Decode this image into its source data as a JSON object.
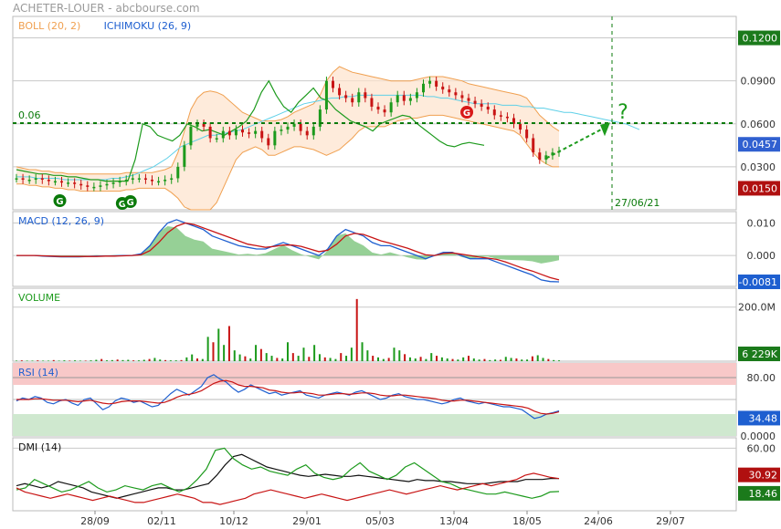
{
  "header": {
    "title": "ACHETER-LOUER - abcbourse.com"
  },
  "colors": {
    "green": "#1c9a1c",
    "darkgreen": "#0a7a0a",
    "red": "#c81414",
    "blue": "#1e5fd0",
    "orange": "#f0a050",
    "cyan": "#5fd0e8",
    "pink_band": "#f8c8c8",
    "green_band": "#cfe8cf",
    "grid": "#c8c8c8",
    "black": "#111111"
  },
  "chart_data": [
    {
      "name": "price",
      "type": "line",
      "legend": [
        {
          "label": "BOLL (20, 2)",
          "color": "#f0a050"
        },
        {
          "label": "ICHIMOKU (26, 9)",
          "color": "#1e5fd0"
        }
      ],
      "y_ticks": [
        "0.1200",
        "0.0900",
        "0.0600",
        "0.0300"
      ],
      "y_tick_values": [
        0.12,
        0.09,
        0.06,
        0.03
      ],
      "ylim": [
        0.0,
        0.135
      ],
      "hline_label": "0.06",
      "hline_value": 0.0605,
      "last_value_label": "0.0457",
      "last_value": 0.0457,
      "red_label": "0.0150",
      "red_value": 0.015,
      "top_label": "0.1200",
      "vline_date_label": "27/06/21",
      "question_mark": "?",
      "signals": [
        {
          "label": "G",
          "color": "#0a7a0a",
          "x_frac": 0.08
        },
        {
          "label": "G",
          "color": "#0a7a0a",
          "x_frac": 0.195
        },
        {
          "label": "G",
          "color": "#0a7a0a",
          "x_frac": 0.21
        },
        {
          "label": "G",
          "color": "#d81818",
          "x_frac": 0.83
        }
      ],
      "close": [
        0.022,
        0.021,
        0.021,
        0.022,
        0.021,
        0.02,
        0.02,
        0.019,
        0.019,
        0.018,
        0.017,
        0.016,
        0.016,
        0.017,
        0.018,
        0.019,
        0.02,
        0.021,
        0.022,
        0.022,
        0.021,
        0.02,
        0.02,
        0.021,
        0.022,
        0.03,
        0.045,
        0.058,
        0.06,
        0.058,
        0.05,
        0.05,
        0.055,
        0.052,
        0.056,
        0.054,
        0.053,
        0.055,
        0.05,
        0.045,
        0.055,
        0.056,
        0.058,
        0.06,
        0.055,
        0.052,
        0.058,
        0.07,
        0.09,
        0.085,
        0.08,
        0.078,
        0.075,
        0.082,
        0.078,
        0.072,
        0.07,
        0.068,
        0.075,
        0.08,
        0.076,
        0.078,
        0.082,
        0.088,
        0.09,
        0.086,
        0.084,
        0.082,
        0.08,
        0.078,
        0.076,
        0.074,
        0.072,
        0.07,
        0.066,
        0.065,
        0.064,
        0.06,
        0.056,
        0.05,
        0.04,
        0.035,
        0.038,
        0.04,
        0.041
      ],
      "bb_upper": [
        0.03,
        0.029,
        0.028,
        0.028,
        0.027,
        0.027,
        0.026,
        0.026,
        0.025,
        0.025,
        0.025,
        0.025,
        0.025,
        0.025,
        0.025,
        0.025,
        0.025,
        0.026,
        0.026,
        0.026,
        0.026,
        0.026,
        0.027,
        0.028,
        0.03,
        0.04,
        0.055,
        0.07,
        0.078,
        0.082,
        0.083,
        0.082,
        0.08,
        0.076,
        0.072,
        0.068,
        0.066,
        0.064,
        0.062,
        0.062,
        0.062,
        0.063,
        0.065,
        0.068,
        0.07,
        0.072,
        0.074,
        0.08,
        0.09,
        0.096,
        0.1,
        0.098,
        0.096,
        0.095,
        0.094,
        0.093,
        0.092,
        0.091,
        0.09,
        0.09,
        0.09,
        0.09,
        0.091,
        0.092,
        0.093,
        0.093,
        0.093,
        0.092,
        0.091,
        0.09,
        0.088,
        0.087,
        0.086,
        0.085,
        0.084,
        0.083,
        0.082,
        0.081,
        0.08,
        0.078,
        0.072,
        0.066,
        0.062,
        0.058,
        0.055
      ],
      "bb_lower": [
        0.018,
        0.018,
        0.017,
        0.017,
        0.016,
        0.016,
        0.015,
        0.015,
        0.014,
        0.014,
        0.013,
        0.013,
        0.013,
        0.013,
        0.013,
        0.013,
        0.013,
        0.014,
        0.014,
        0.015,
        0.015,
        0.015,
        0.015,
        0.015,
        0.012,
        0.008,
        0.002,
        -0.008,
        -0.012,
        -0.01,
        -0.005,
        0.005,
        0.015,
        0.025,
        0.035,
        0.04,
        0.042,
        0.044,
        0.042,
        0.038,
        0.038,
        0.04,
        0.042,
        0.044,
        0.044,
        0.043,
        0.042,
        0.04,
        0.038,
        0.04,
        0.042,
        0.046,
        0.05,
        0.055,
        0.058,
        0.058,
        0.058,
        0.058,
        0.06,
        0.062,
        0.063,
        0.064,
        0.064,
        0.065,
        0.066,
        0.066,
        0.066,
        0.065,
        0.064,
        0.063,
        0.062,
        0.061,
        0.06,
        0.059,
        0.058,
        0.057,
        0.056,
        0.055,
        0.052,
        0.046,
        0.04,
        0.035,
        0.032,
        0.03,
        0.03
      ],
      "ichimoku_lagging": [
        0.028,
        0.027,
        0.026,
        0.025,
        0.025,
        0.024,
        0.024,
        0.023,
        0.023,
        0.022,
        0.021,
        0.021,
        0.02,
        0.02,
        0.02,
        0.02,
        0.035,
        0.06,
        0.058,
        0.052,
        0.05,
        0.048,
        0.052,
        0.06,
        0.058,
        0.055,
        0.056,
        0.054,
        0.052,
        0.055,
        0.058,
        0.062,
        0.07,
        0.082,
        0.09,
        0.08,
        0.072,
        0.068,
        0.075,
        0.08,
        0.085,
        0.078,
        0.076,
        0.07,
        0.066,
        0.062,
        0.06,
        0.058,
        0.055,
        0.06,
        0.062,
        0.064,
        0.066,
        0.065,
        0.06,
        0.056,
        0.052,
        0.048,
        0.045,
        0.044,
        0.046,
        0.047,
        0.046,
        0.045
      ],
      "ichimoku_cloud": [
        0.023,
        0.023,
        0.023,
        0.022,
        0.022,
        0.022,
        0.022,
        0.021,
        0.021,
        0.021,
        0.021,
        0.021,
        0.021,
        0.021,
        0.022,
        0.022,
        0.023,
        0.024,
        0.026,
        0.028,
        0.03,
        0.033,
        0.036,
        0.04,
        0.044,
        0.046,
        0.048,
        0.05,
        0.052,
        0.052,
        0.053,
        0.054,
        0.055,
        0.056,
        0.058,
        0.06,
        0.062,
        0.064,
        0.066,
        0.068,
        0.07,
        0.072,
        0.074,
        0.075,
        0.076,
        0.077,
        0.078,
        0.078,
        0.079,
        0.079,
        0.08,
        0.08,
        0.08,
        0.08,
        0.08,
        0.08,
        0.08,
        0.08,
        0.08,
        0.08,
        0.079,
        0.079,
        0.078,
        0.078,
        0.077,
        0.076,
        0.075,
        0.074,
        0.074,
        0.074,
        0.074,
        0.073,
        0.073,
        0.073,
        0.072,
        0.072,
        0.071,
        0.071,
        0.07,
        0.069,
        0.068,
        0.068,
        0.067,
        0.066,
        0.065,
        0.064,
        0.063,
        0.062,
        0.061,
        0.06,
        0.058,
        0.056
      ]
    },
    {
      "name": "macd",
      "type": "line",
      "legend": [
        {
          "label": "MACD (12, 26, 9)",
          "color": "#1e5fd0"
        }
      ],
      "y_ticks": [
        "0.010",
        "0.000"
      ],
      "y_tick_values": [
        0.01,
        0.0
      ],
      "ylim": [
        -0.0095,
        0.0135
      ],
      "last_value_label": "-0.0081",
      "last_value": -0.0081,
      "macd": [
        0.0,
        0.0,
        0.0,
        -0.0002,
        -0.0003,
        -0.0004,
        -0.0004,
        -0.0004,
        -0.0003,
        -0.0002,
        -0.0002,
        -0.0001,
        0.0,
        0.0,
        0.0005,
        0.003,
        0.007,
        0.01,
        0.011,
        0.01,
        0.009,
        0.008,
        0.006,
        0.005,
        0.004,
        0.003,
        0.0025,
        0.002,
        0.002,
        0.003,
        0.004,
        0.003,
        0.002,
        0.001,
        0.0,
        0.002,
        0.006,
        0.008,
        0.007,
        0.006,
        0.004,
        0.003,
        0.003,
        0.002,
        0.001,
        0.0,
        -0.001,
        0.0,
        0.001,
        0.001,
        0.0,
        -0.001,
        -0.001,
        -0.001,
        -0.002,
        -0.003,
        -0.004,
        -0.005,
        -0.006,
        -0.0075,
        -0.008,
        -0.0081
      ],
      "signal": [
        0.0,
        0.0,
        0.0,
        -0.0001,
        -0.0002,
        -0.0003,
        -0.0003,
        -0.0003,
        -0.0003,
        -0.0003,
        -0.0002,
        -0.0002,
        -0.0001,
        0.0,
        0.0002,
        0.0015,
        0.004,
        0.007,
        0.009,
        0.01,
        0.0095,
        0.0085,
        0.0075,
        0.0065,
        0.0055,
        0.0045,
        0.0035,
        0.003,
        0.0025,
        0.0028,
        0.0032,
        0.0032,
        0.0028,
        0.002,
        0.0012,
        0.0016,
        0.0035,
        0.006,
        0.0068,
        0.0065,
        0.0055,
        0.0045,
        0.0038,
        0.003,
        0.0022,
        0.0012,
        0.0002,
        0.0,
        0.0006,
        0.0008,
        0.0004,
        0.0,
        -0.0005,
        -0.0008,
        -0.0012,
        -0.002,
        -0.003,
        -0.004,
        -0.0048,
        -0.0058,
        -0.0068,
        -0.0075
      ]
    },
    {
      "name": "volume",
      "type": "bar",
      "legend": [
        {
          "label": "VOLUME",
          "color": "#1c9a1c"
        }
      ],
      "y_ticks": [
        "200.0M"
      ],
      "y_tick_values": [
        200
      ],
      "ylim": [
        0,
        270
      ],
      "last_value_label": "6 229K",
      "last_value": 6.229,
      "values": [
        2,
        3,
        2,
        2,
        3,
        2,
        2,
        4,
        2,
        3,
        2,
        3,
        2,
        2,
        3,
        5,
        8,
        3,
        4,
        6,
        4,
        5,
        3,
        3,
        5,
        8,
        12,
        6,
        4,
        3,
        3,
        4,
        14,
        25,
        10,
        8,
        90,
        70,
        120,
        60,
        130,
        40,
        25,
        18,
        10,
        60,
        45,
        30,
        20,
        12,
        10,
        70,
        30,
        20,
        50,
        16,
        60,
        26,
        14,
        12,
        8,
        30,
        20,
        50,
        230,
        70,
        40,
        20,
        14,
        8,
        12,
        50,
        40,
        26,
        14,
        10,
        16,
        8,
        30,
        20,
        14,
        10,
        8,
        6,
        14,
        20,
        10,
        6,
        8,
        4,
        6,
        5,
        16,
        12,
        10,
        6,
        6,
        18,
        22,
        12,
        8,
        4,
        3
      ]
    },
    {
      "name": "rsi",
      "type": "line",
      "legend": [
        {
          "label": "RSI (14)",
          "color": "#1e5fd0"
        }
      ],
      "y_ticks": [
        "80.00",
        "0.0000"
      ],
      "y_tick_values": [
        80,
        0
      ],
      "ylim": [
        0,
        100
      ],
      "overbought": 70,
      "oversold": 30,
      "last_value_label": "34.48",
      "last_value": 34.48,
      "rsi": [
        48,
        52,
        50,
        54,
        52,
        46,
        44,
        48,
        50,
        45,
        42,
        50,
        52,
        44,
        36,
        40,
        48,
        52,
        50,
        46,
        48,
        44,
        40,
        42,
        50,
        58,
        64,
        60,
        56,
        62,
        68,
        80,
        84,
        78,
        74,
        66,
        60,
        64,
        70,
        66,
        62,
        58,
        60,
        56,
        58,
        60,
        62,
        56,
        54,
        52,
        56,
        58,
        60,
        58,
        56,
        60,
        62,
        58,
        54,
        50,
        52,
        56,
        58,
        54,
        52,
        50,
        50,
        48,
        46,
        44,
        46,
        50,
        52,
        48,
        46,
        44,
        46,
        44,
        42,
        40,
        40,
        38,
        36,
        30,
        24,
        26,
        30,
        32,
        34.48
      ],
      "signal": [
        50,
        50,
        50,
        51,
        51,
        50,
        49,
        49,
        49,
        48,
        47,
        48,
        49,
        47,
        45,
        44,
        45,
        47,
        48,
        48,
        48,
        47,
        46,
        45,
        46,
        49,
        53,
        56,
        57,
        59,
        62,
        67,
        72,
        75,
        76,
        74,
        70,
        68,
        68,
        67,
        66,
        63,
        62,
        60,
        59,
        59,
        60,
        59,
        58,
        56,
        56,
        57,
        58,
        58,
        57,
        58,
        59,
        59,
        58,
        56,
        55,
        55,
        56,
        56,
        55,
        54,
        53,
        52,
        51,
        49,
        48,
        48,
        49,
        49,
        48,
        47,
        46,
        45,
        44,
        43,
        42,
        41,
        40,
        38,
        34,
        31,
        30,
        31,
        33
      ]
    },
    {
      "name": "dmi",
      "type": "line",
      "legend": [
        {
          "label": "DMI (14)",
          "color": "#111111"
        }
      ],
      "y_ticks": [
        "60.00"
      ],
      "y_tick_values": [
        60
      ],
      "ylim": [
        0,
        70
      ],
      "last_value_labels": [
        "30.92",
        "18.46"
      ],
      "last_values": [
        30.92,
        18.46
      ],
      "adx": [
        24,
        26,
        24,
        22,
        24,
        28,
        26,
        24,
        22,
        18,
        16,
        14,
        12,
        14,
        16,
        18,
        20,
        22,
        22,
        20,
        20,
        22,
        24,
        26,
        34,
        44,
        52,
        54,
        50,
        46,
        42,
        40,
        38,
        36,
        34,
        33,
        34,
        35,
        34,
        33,
        33,
        34,
        33,
        32,
        31,
        30,
        29,
        28,
        30,
        29,
        29,
        28,
        28,
        27,
        26,
        26,
        26,
        27,
        28,
        28,
        28,
        30,
        30,
        30,
        31,
        30.92
      ],
      "di_plus": [
        20,
        22,
        30,
        26,
        22,
        18,
        20,
        24,
        28,
        22,
        18,
        20,
        24,
        22,
        20,
        24,
        26,
        22,
        18,
        22,
        30,
        40,
        58,
        60,
        50,
        44,
        40,
        42,
        38,
        36,
        34,
        40,
        44,
        36,
        32,
        30,
        32,
        40,
        46,
        38,
        34,
        30,
        34,
        42,
        46,
        40,
        34,
        28,
        26,
        22,
        20,
        18,
        16,
        16,
        18,
        16,
        14,
        12,
        14,
        18,
        18.46
      ],
      "di_minus": [
        22,
        18,
        16,
        14,
        12,
        14,
        16,
        14,
        12,
        10,
        12,
        14,
        12,
        10,
        8,
        8,
        10,
        12,
        14,
        16,
        14,
        12,
        8,
        8,
        6,
        8,
        10,
        12,
        16,
        18,
        20,
        18,
        16,
        14,
        12,
        14,
        16,
        14,
        12,
        10,
        12,
        14,
        16,
        18,
        20,
        18,
        16,
        18,
        20,
        22,
        24,
        22,
        20,
        22,
        24,
        26,
        24,
        26,
        28,
        30,
        34,
        36,
        34,
        32,
        30.92
      ]
    },
    {
      "name": "x_axis",
      "type": "table",
      "x_ticks": [
        "28/09",
        "02/11",
        "10/12",
        "29/01",
        "05/03",
        "13/04",
        "18/05",
        "24/06",
        "29/07"
      ]
    }
  ]
}
